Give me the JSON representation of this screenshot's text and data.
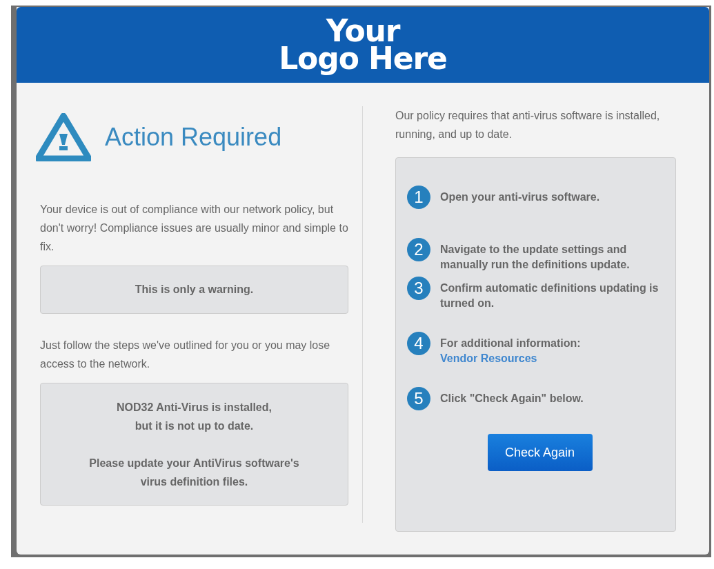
{
  "header": {
    "logo_lines": [
      "Your",
      "Logo Here"
    ]
  },
  "title": "Action Required",
  "intro": "Your device is out of compliance with our network policy, but don't worry! Compliance issues are usually minor and simple to fix.",
  "warning": "This is only a warning.",
  "follow": "Just follow the steps we've outlined for you or you may lose access to the network.",
  "status_lines": [
    [
      "NOD32 Anti-Virus is installed,",
      "but it is not up to date."
    ],
    [
      "Please update your AntiVirus software's",
      "virus definition files."
    ]
  ],
  "policy": "Our policy requires that anti-virus software is installed, running, and up to date.",
  "steps": [
    {
      "number": "1",
      "text": "Open your anti-virus software."
    },
    {
      "number": "2",
      "text": "Navigate to the update settings and manually run the definitions update."
    },
    {
      "number": "3",
      "text": "Confirm automatic definitions updating is turned on."
    },
    {
      "number": "4",
      "text": "For additional information:",
      "link": "Vendor Resources"
    },
    {
      "number": "5",
      "text": "Click \"Check Again\" below."
    }
  ],
  "button": "Check Again"
}
